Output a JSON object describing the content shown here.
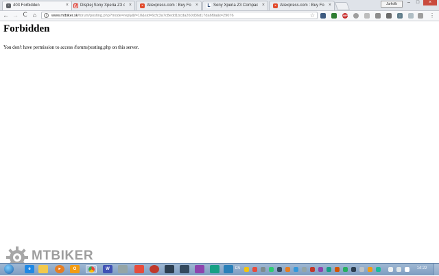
{
  "browser": {
    "tabs": [
      {
        "title": "403 Forbidden",
        "favicon": "page-icon",
        "favicon_color": "#5f6368",
        "active": true
      },
      {
        "title": "Displej Sony Xperia Z3 c",
        "favicon": "gmail-icon",
        "favicon_color": "#d93025",
        "active": false
      },
      {
        "title": "Aliexpress.com : Buy Fo",
        "favicon": "aliexpress-icon",
        "favicon_color": "#e24a2b",
        "active": false
      },
      {
        "title": "Sony Xperia Z3 Compact",
        "favicon": "L",
        "favicon_color": "#1a3a6b",
        "active": false
      },
      {
        "title": "Aliexpress.com : Buy Fo",
        "favicon": "aliexpress-icon",
        "favicon_color": "#e24a2b",
        "active": false
      }
    ],
    "close_glyph": "×",
    "user_label": "Jurkolb",
    "window_controls": {
      "minimize": "–",
      "maximize": "□",
      "close": "×"
    },
    "url_host": "www.mtbiker.sk",
    "url_path": "/forum/posting.php?mode=reply&f=10&sid=6cfc3a7c8edd1bcda260d36d17da6f9a&t=29076",
    "nav": {
      "back": "←",
      "forward": "→",
      "reload": "C",
      "home": "⌂"
    },
    "star": "☆",
    "menu": "⋮",
    "extensions": [
      {
        "name": "extension-icon-1",
        "color": "#3d5a80"
      },
      {
        "name": "extension-icon-2",
        "color": "#2e7d32"
      },
      {
        "name": "adblock-icon",
        "color": "#c62828",
        "label": "ABP"
      },
      {
        "name": "extension-icon-4",
        "color": "#9e9e9e"
      },
      {
        "name": "extension-icon-5",
        "color": "#bdbdbd"
      },
      {
        "name": "extension-icon-6",
        "color": "#8d8d8d"
      },
      {
        "name": "extension-icon-7",
        "color": "#6b6b6b"
      },
      {
        "name": "download-icon",
        "color": "#607d8b"
      },
      {
        "name": "extension-icon-9",
        "color": "#b0bec5"
      },
      {
        "name": "extension-icon-10",
        "color": "#9e9e9e"
      },
      {
        "name": "extension-icon-11",
        "color": "#cfd8dc"
      }
    ]
  },
  "page": {
    "heading": "Forbidden",
    "message": "You don't have permission to access /forum/posting.php on this server."
  },
  "watermark": {
    "text": "MTBIKER",
    "color": "#7d7d7d"
  },
  "taskbar": {
    "items": [
      {
        "name": "start-button",
        "color": "#2b6cb0"
      },
      {
        "name": "ie-icon",
        "color": "#1e88e5"
      },
      {
        "name": "explorer-icon",
        "color": "#f2c94c"
      },
      {
        "name": "media-player-icon",
        "color": "#e67e22"
      },
      {
        "name": "outlook-icon",
        "color": "#f39c12",
        "label": "O"
      },
      {
        "name": "chrome-icon",
        "color": "#34a853",
        "active": true
      },
      {
        "name": "document-icon",
        "color": "#3f51b5"
      },
      {
        "name": "app-icon-8",
        "color": "#95a5a6"
      },
      {
        "name": "app-icon-9",
        "color": "#e74c3c"
      },
      {
        "name": "app-icon-10",
        "color": "#c0392b"
      },
      {
        "name": "app-icon-11",
        "color": "#2c3e50"
      },
      {
        "name": "app-icon-12",
        "color": "#34495e"
      },
      {
        "name": "app-icon-13",
        "color": "#8e44ad"
      },
      {
        "name": "app-icon-14",
        "color": "#16a085"
      },
      {
        "name": "app-icon-15",
        "color": "#2980b9"
      },
      {
        "name": "app-icon-16",
        "color": "#27ae60"
      }
    ],
    "language": "EN",
    "clock": "14:22"
  }
}
